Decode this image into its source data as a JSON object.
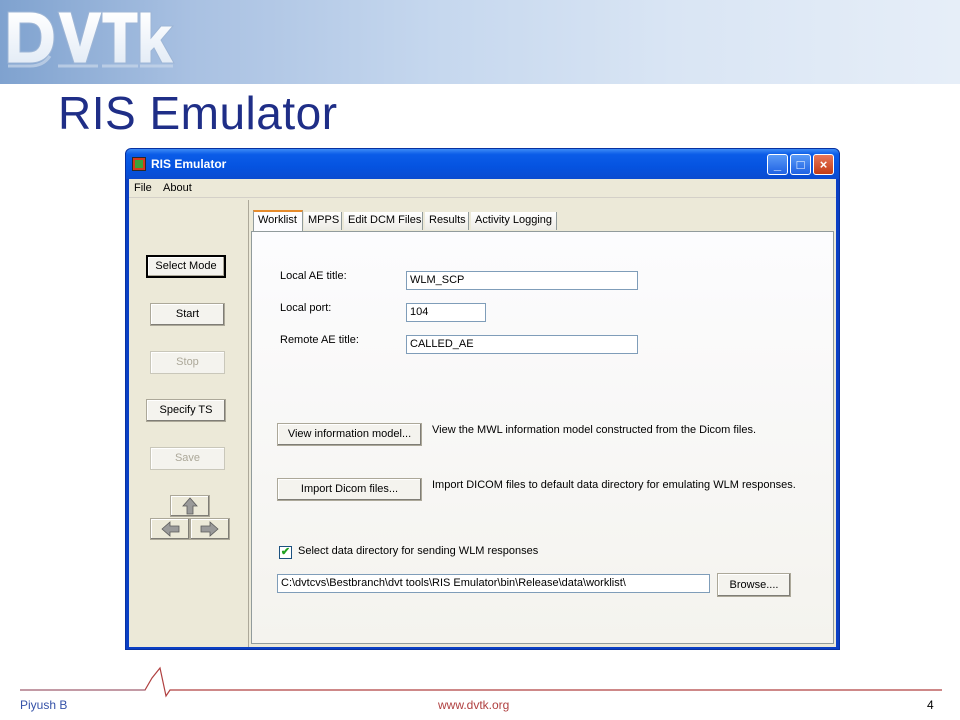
{
  "slide": {
    "title": "RIS Emulator",
    "logo_text": "DVTk",
    "footer": {
      "author": "Piyush B",
      "url": "www.dvtk.org",
      "page": "4"
    }
  },
  "window": {
    "title": "RIS Emulator",
    "controls": {
      "minimize": "_",
      "maximize": "□",
      "close": "×"
    }
  },
  "menu": [
    "File",
    "About"
  ],
  "sidebar": {
    "buttons": [
      {
        "label": "Select Mode",
        "enabled": true
      },
      {
        "label": "Start",
        "enabled": true
      },
      {
        "label": "Stop",
        "enabled": false
      },
      {
        "label": "Specify TS",
        "enabled": true
      },
      {
        "label": "Save",
        "enabled": false
      }
    ],
    "arrows": {
      "up": "up-arrow-icon",
      "left": "left-arrow-icon",
      "right": "right-arrow-icon"
    }
  },
  "tabs": [
    "Worklist",
    "MPPS",
    "Edit DCM Files",
    "Results",
    "Activity Logging"
  ],
  "worklist": {
    "local_ae_label": "Local AE title:",
    "local_ae_value": "WLM_SCP",
    "local_port_label": "Local port:",
    "local_port_value": "104",
    "remote_ae_label": "Remote AE title:",
    "remote_ae_value": "CALLED_AE",
    "view_model_button": "View information model...",
    "view_model_desc": "View the MWL information model constructed from the Dicom files.",
    "import_button": "Import Dicom files...",
    "import_desc": "Import DICOM files to default data directory for emulating WLM responses.",
    "select_dir_checked": true,
    "select_dir_label": "Select data directory for sending WLM responses",
    "data_dir_value": "C:\\dvtcvs\\Bestbranch\\dvt tools\\RIS Emulator\\bin\\Release\\data\\worklist\\",
    "browse_button": "Browse...."
  },
  "colors": {
    "title_blue": "#1f2e87",
    "xp_titlebar": "#0553e0",
    "tab_highlight": "#e68b2c"
  }
}
